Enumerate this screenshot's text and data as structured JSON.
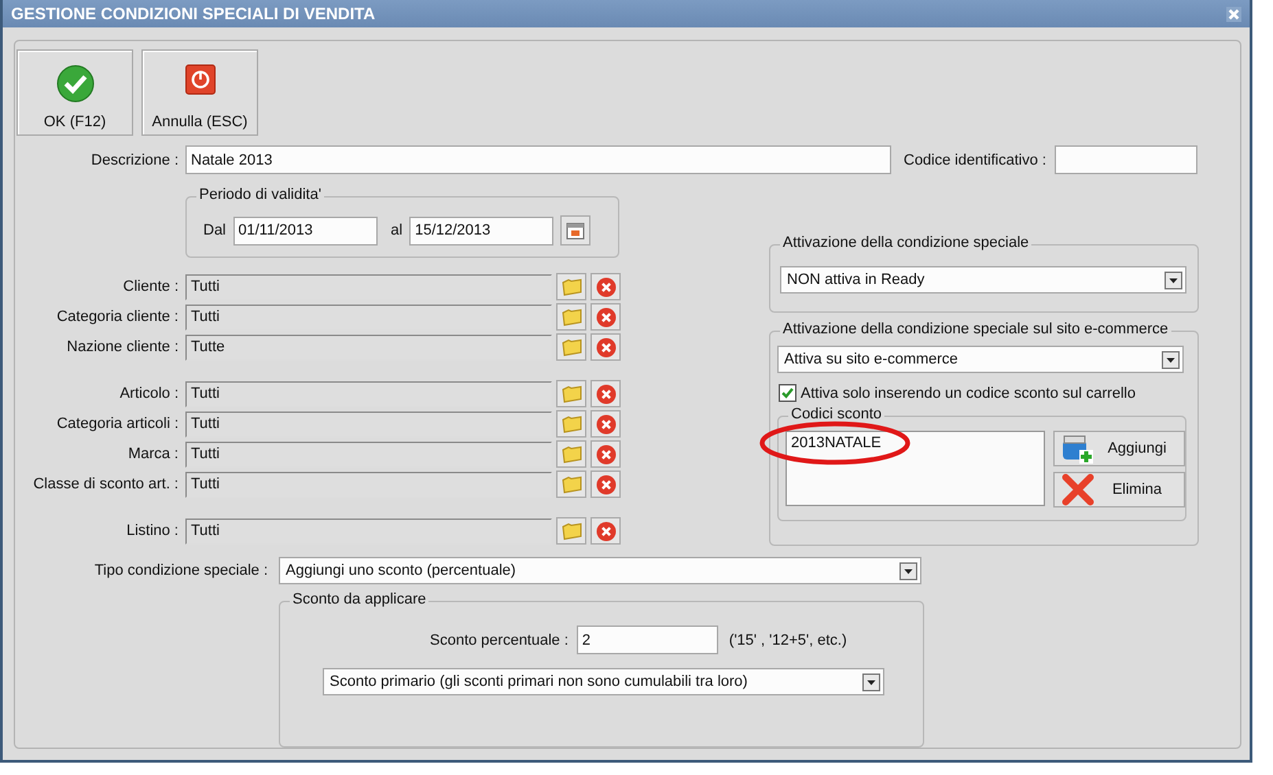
{
  "window": {
    "title": "GESTIONE CONDIZIONI SPECIALI DI VENDITA"
  },
  "toolbar": [
    {
      "kind": "ok",
      "label": "OK (F12)"
    },
    {
      "kind": "cancel",
      "label": "Annulla (ESC)"
    }
  ],
  "descrizione": {
    "label": "Descrizione :",
    "value": "Natale 2013"
  },
  "codice_identificativo": {
    "label": "Codice identificativo :"
  },
  "periodo": {
    "legend": "Periodo di validita'",
    "from_label": "Dal",
    "from": "01/11/2013",
    "to_label": "al",
    "to": "15/12/2013"
  },
  "lookup_groups": [
    {
      "fields": [
        {
          "label": "Cliente :",
          "value": "Tutti"
        },
        {
          "label": "Categoria cliente :",
          "value": "Tutti"
        },
        {
          "label": "Nazione cliente :",
          "value": "Tutte"
        }
      ]
    },
    {
      "fields": [
        {
          "label": "Articolo :",
          "value": "Tutti"
        },
        {
          "label": "Categoria articoli :",
          "value": "Tutti"
        },
        {
          "label": "Marca :",
          "value": "Tutti"
        },
        {
          "label": "Classe di sconto art. :",
          "value": "Tutti"
        }
      ]
    },
    {
      "fields": [
        {
          "label": "Listino :",
          "value": "Tutti"
        }
      ]
    }
  ],
  "attivazione": {
    "legend": "Attivazione della condizione speciale",
    "value": "NON attiva in Ready"
  },
  "ecommerce": {
    "legend": "Attivazione della condizione speciale sul sito e-commerce",
    "value": "Attiva su sito e-commerce",
    "checkbox": {
      "label": "Attiva solo inserendo un codice sconto sul carrello",
      "checked": true
    },
    "codici": {
      "legend": "Codici sconto",
      "items": [
        {
          "code": "2013NATALE",
          "circled": true
        }
      ],
      "buttons": [
        {
          "kind": "add",
          "label": "Aggiungi"
        },
        {
          "kind": "delete",
          "label": "Elimina"
        }
      ]
    }
  },
  "tipo": {
    "label": "Tipo condizione speciale :",
    "value": "Aggiungi uno sconto (percentuale)"
  },
  "sconto": {
    "legend": "Sconto da applicare",
    "label": "Sconto percentuale :",
    "value": "2",
    "hint": "('15' ,  '12+5', etc.)",
    "type_value": "Sconto primario (gli sconti primari non sono cumulabili tra loro)"
  }
}
